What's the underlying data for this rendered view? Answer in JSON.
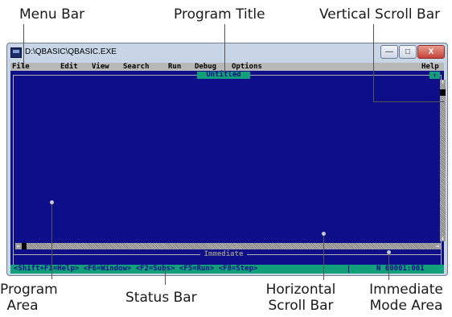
{
  "callouts": {
    "menu_bar": "Menu Bar",
    "program_title": "Program Title",
    "vertical_scroll_bar": "Vertical Scroll Bar",
    "program_area_1": "Program",
    "program_area_2": "Area",
    "status_bar": "Status Bar",
    "horizontal_1": "Horizontal",
    "horizontal_2": "Scroll Bar",
    "immediate_1": "Immediate",
    "immediate_2": "Mode Area"
  },
  "window": {
    "title": "D:\\QBASIC\\QBASIC.EXE",
    "controls": {
      "minimize": "—",
      "maximize": "□",
      "close": "X"
    }
  },
  "menubar": {
    "items": [
      "File",
      "Edit",
      "View",
      "Search",
      "Run",
      "Debug",
      "Options"
    ],
    "help": "Help"
  },
  "program": {
    "title": "Untitled",
    "maximize_glyph": "↑"
  },
  "scrollbars": {
    "up_arrow": "↑",
    "down_arrow": "↓",
    "left_arrow": "←",
    "right_arrow": "→"
  },
  "immediate": {
    "title": "Immediate"
  },
  "statusbar": {
    "text": "<Shift+F1=Help> <F6=Window> <F2=Subs> <F5=Run> <F8=Step>",
    "mode": "N",
    "position": "00001:001"
  },
  "colors": {
    "dos_blue": "#0e0e8a",
    "dos_gray": "#b8b8b8",
    "dos_green": "#11a07a",
    "frame_blue": "#c7d5e6"
  },
  "icons": {
    "app_icon": "qbasic-app-icon",
    "minimize": "minimize-icon",
    "maximize": "maximize-icon",
    "close": "close-icon"
  }
}
